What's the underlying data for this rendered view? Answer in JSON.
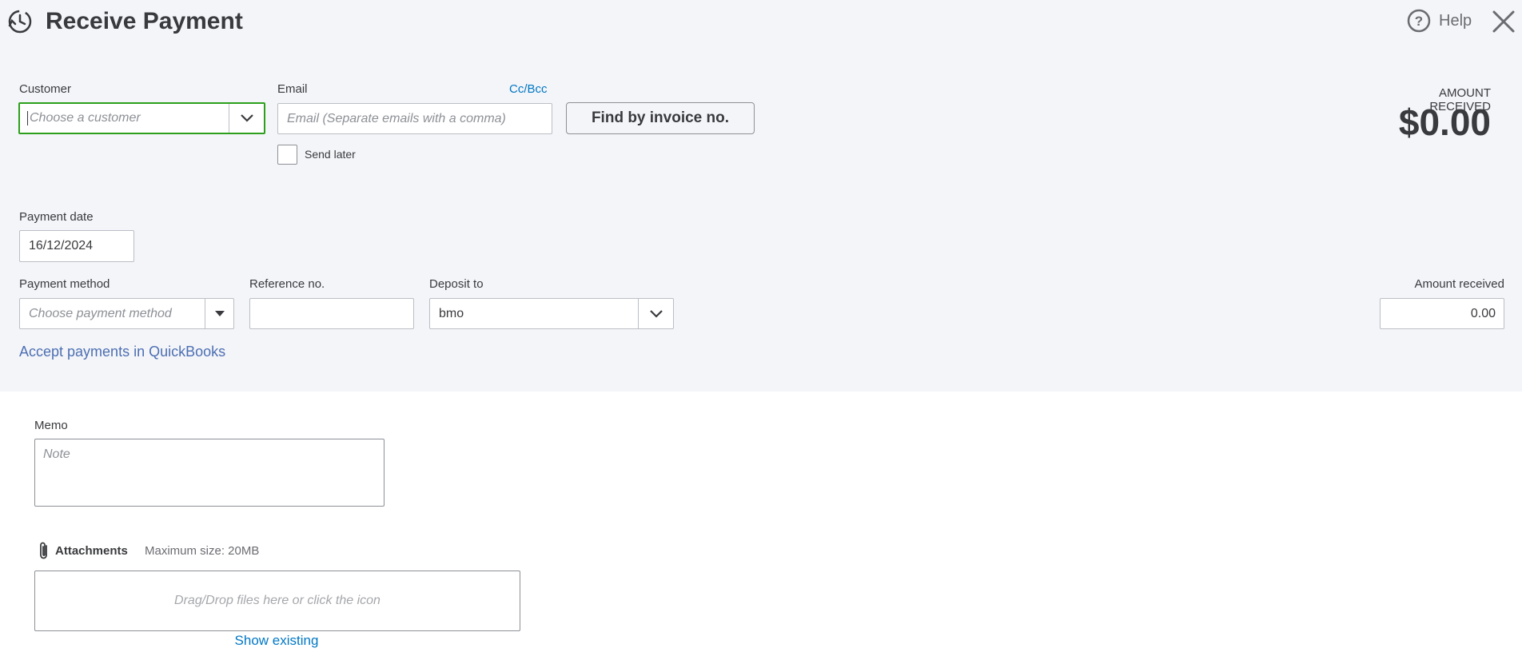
{
  "header": {
    "title": "Receive Payment",
    "help_label": "Help"
  },
  "customer": {
    "label": "Customer",
    "placeholder": "Choose a customer"
  },
  "email": {
    "label": "Email",
    "cc_bcc": "Cc/Bcc",
    "placeholder": "Email (Separate emails with a comma)",
    "send_later": "Send later"
  },
  "find_invoice_label": "Find by invoice no.",
  "amount_received_summary": {
    "label": "AMOUNT RECEIVED",
    "value": "$0.00"
  },
  "payment_date": {
    "label": "Payment date",
    "value": "16/12/2024"
  },
  "payment_method": {
    "label": "Payment method",
    "placeholder": "Choose payment method"
  },
  "reference": {
    "label": "Reference no.",
    "value": ""
  },
  "deposit_to": {
    "label": "Deposit to",
    "value": "bmo"
  },
  "amount_received": {
    "label": "Amount received",
    "value": "0.00"
  },
  "accept_payments_link": "Accept payments in QuickBooks",
  "memo": {
    "label": "Memo",
    "placeholder": "Note"
  },
  "attachments": {
    "label": "Attachments",
    "max_size": "Maximum size: 20MB",
    "dropzone_text": "Drag/Drop files here or click the icon",
    "show_existing": "Show existing"
  },
  "colors": {
    "accent_green": "#2ca01c",
    "link_blue": "#0077c5",
    "header_bg": "#f4f5f8"
  }
}
